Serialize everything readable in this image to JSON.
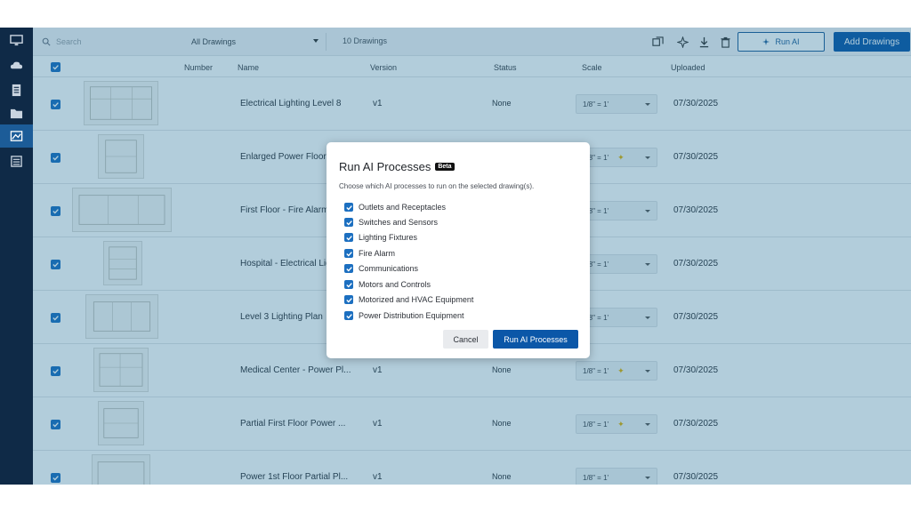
{
  "sidebar": {
    "items": [
      {
        "icon": "monitor-icon"
      },
      {
        "icon": "cloud-icon"
      },
      {
        "icon": "document-icon"
      },
      {
        "icon": "folder-icon"
      },
      {
        "icon": "drawings-icon"
      },
      {
        "icon": "list-icon"
      }
    ]
  },
  "toolbar": {
    "search_placeholder": "Search",
    "filter_value": "All Drawings",
    "drawing_count": "10 Drawings",
    "run_ai_label": "Run AI",
    "add_drawings_label": "Add Drawings"
  },
  "table": {
    "columns": {
      "number": "Number",
      "name": "Name",
      "version": "Version",
      "status": "Status",
      "scale": "Scale",
      "uploaded": "Uploaded"
    },
    "rows": [
      {
        "name": "Electrical Lighting Level 8",
        "version": "v1",
        "status": "None",
        "scale": "1/8\" = 1'",
        "uploaded": "07/30/2025"
      },
      {
        "name": "Enlarged Power Floor",
        "version": "",
        "status": "",
        "scale": "1/8\" = 1'",
        "uploaded": "07/30/2025"
      },
      {
        "name": "First Floor - Fire Alarm",
        "version": "",
        "status": "",
        "scale": "1/8\" = 1'",
        "uploaded": "07/30/2025"
      },
      {
        "name": "Hospital - Electrical Lig",
        "version": "",
        "status": "",
        "scale": "1/8\" = 1'",
        "uploaded": "07/30/2025"
      },
      {
        "name": "Level 3 Lighting Plan",
        "version": "",
        "status": "",
        "scale": "1/8\" = 1'",
        "uploaded": "07/30/2025"
      },
      {
        "name": "Medical Center - Power Pl...",
        "version": "v1",
        "status": "None",
        "scale": "1/8\" = 1'",
        "uploaded": "07/30/2025"
      },
      {
        "name": "Partial First Floor Power ...",
        "version": "v1",
        "status": "None",
        "scale": "1/8\" = 1'",
        "uploaded": "07/30/2025"
      },
      {
        "name": "Power 1st Floor Partial Pl...",
        "version": "v1",
        "status": "None",
        "scale": "1/8\" = 1'",
        "uploaded": "07/30/2025"
      }
    ]
  },
  "modal": {
    "title": "Run AI Processes",
    "badge": "Beta",
    "subtitle": "Choose which AI processes to run on the selected drawing(s).",
    "options": [
      "Outlets and Receptacles",
      "Switches and Sensors",
      "Lighting Fixtures",
      "Fire Alarm",
      "Communications",
      "Motors and Controls",
      "Motorized and HVAC Equipment",
      "Power Distribution Equipment"
    ],
    "cancel_label": "Cancel",
    "confirm_label": "Run AI Processes"
  },
  "colors": {
    "sidebar": "#0f2a47",
    "primary": "#0b57a8",
    "checkbox": "#1c6fc0",
    "overlay": "#156691"
  }
}
